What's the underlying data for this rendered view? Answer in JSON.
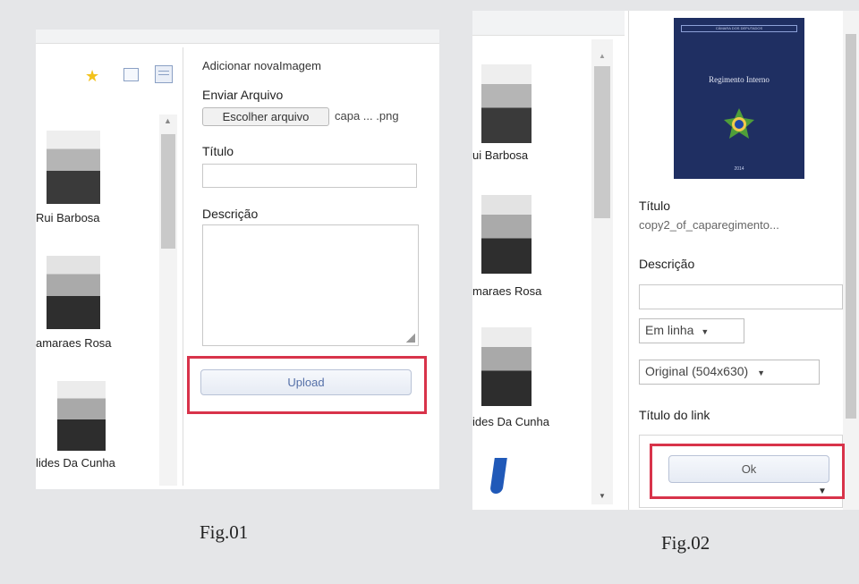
{
  "fig1": {
    "caption": "Fig.01",
    "people": [
      {
        "name": "Rui Barbosa"
      },
      {
        "name": "amaraes Rosa"
      },
      {
        "name": "lides Da Cunha"
      }
    ],
    "form": {
      "heading": "Adicionar novaImagem",
      "file_label": "Enviar Arquivo",
      "choose_button": "Escolher arquivo",
      "file_name": "capa ... .png",
      "title_label": "Título",
      "title_value": "",
      "description_label": "Descrição",
      "description_value": "",
      "upload_button": "Upload"
    },
    "accent": "#d8334a"
  },
  "fig2": {
    "caption": "Fig.02",
    "people": [
      {
        "name": "ui Barbosa"
      },
      {
        "name": "maraes Rosa"
      },
      {
        "name": "ides Da Cunha"
      }
    ],
    "cover": {
      "header": "CÂMARA DOS DEPUTADOS",
      "title": "Regimento Interno",
      "footer": "2014"
    },
    "details": {
      "title_label": "Título",
      "title_value": "copy2_of_caparegimento...",
      "description_label": "Descrição",
      "description_value": "",
      "align_select": "Em linha",
      "size_select": "Original (504x630)",
      "link_title_label": "Título do link",
      "ok_button": "Ok"
    }
  }
}
